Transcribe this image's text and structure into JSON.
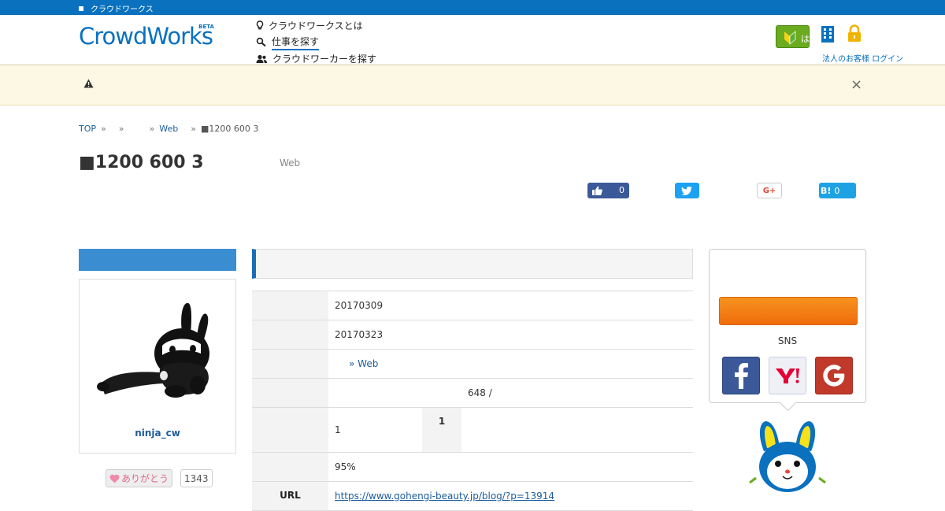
{
  "topbar": {
    "link_label": "クラウドワークス"
  },
  "header": {
    "logo": "CrowdWorks",
    "logo_badge": "BETA",
    "nav": [
      {
        "label": "クラウドワークスとは",
        "icon": "lightbulb-icon"
      },
      {
        "label": "仕事を探す",
        "icon": "search-icon"
      },
      {
        "label": "クラウドワーカーを探す",
        "icon": "users-icon"
      }
    ],
    "beginner_label": "はじめての方",
    "right_sub_label": "法人のお客様 ログイン"
  },
  "alert": {
    "icon": "warning-icon",
    "close": "×"
  },
  "breadcrumb": {
    "items": [
      "TOP",
      "",
      "",
      "Web",
      "■1200 600 3"
    ],
    "separator": "»"
  },
  "job": {
    "title": "■1200 600 3",
    "category": "Web"
  },
  "share": {
    "facebook_count": "0",
    "twitter_icon": "twitter-icon",
    "gplus_label": "G+",
    "hatena_label": "B!",
    "hatena_count": "0"
  },
  "profile": {
    "username": "ninja_cw",
    "thanks_label": "ありがとう",
    "thanks_count": "1343"
  },
  "details": {
    "rows": [
      {
        "label": "",
        "value": "20170309"
      },
      {
        "label": "",
        "value": "20170323"
      },
      {
        "label": "",
        "value": "» Web",
        "link_text": "Web"
      },
      {
        "label": "",
        "value": "648 /"
      },
      {
        "label": "",
        "value": "1",
        "sub_label": "1"
      },
      {
        "label": "",
        "value": "95%"
      },
      {
        "label": "URL",
        "value": "https://www.gohengi-beauty.jp/blog/?p=13914"
      }
    ]
  },
  "sidebar_right": {
    "sns_label": "SNS",
    "sns_icons": [
      "facebook-icon",
      "yahoo-icon",
      "google-icon"
    ]
  }
}
